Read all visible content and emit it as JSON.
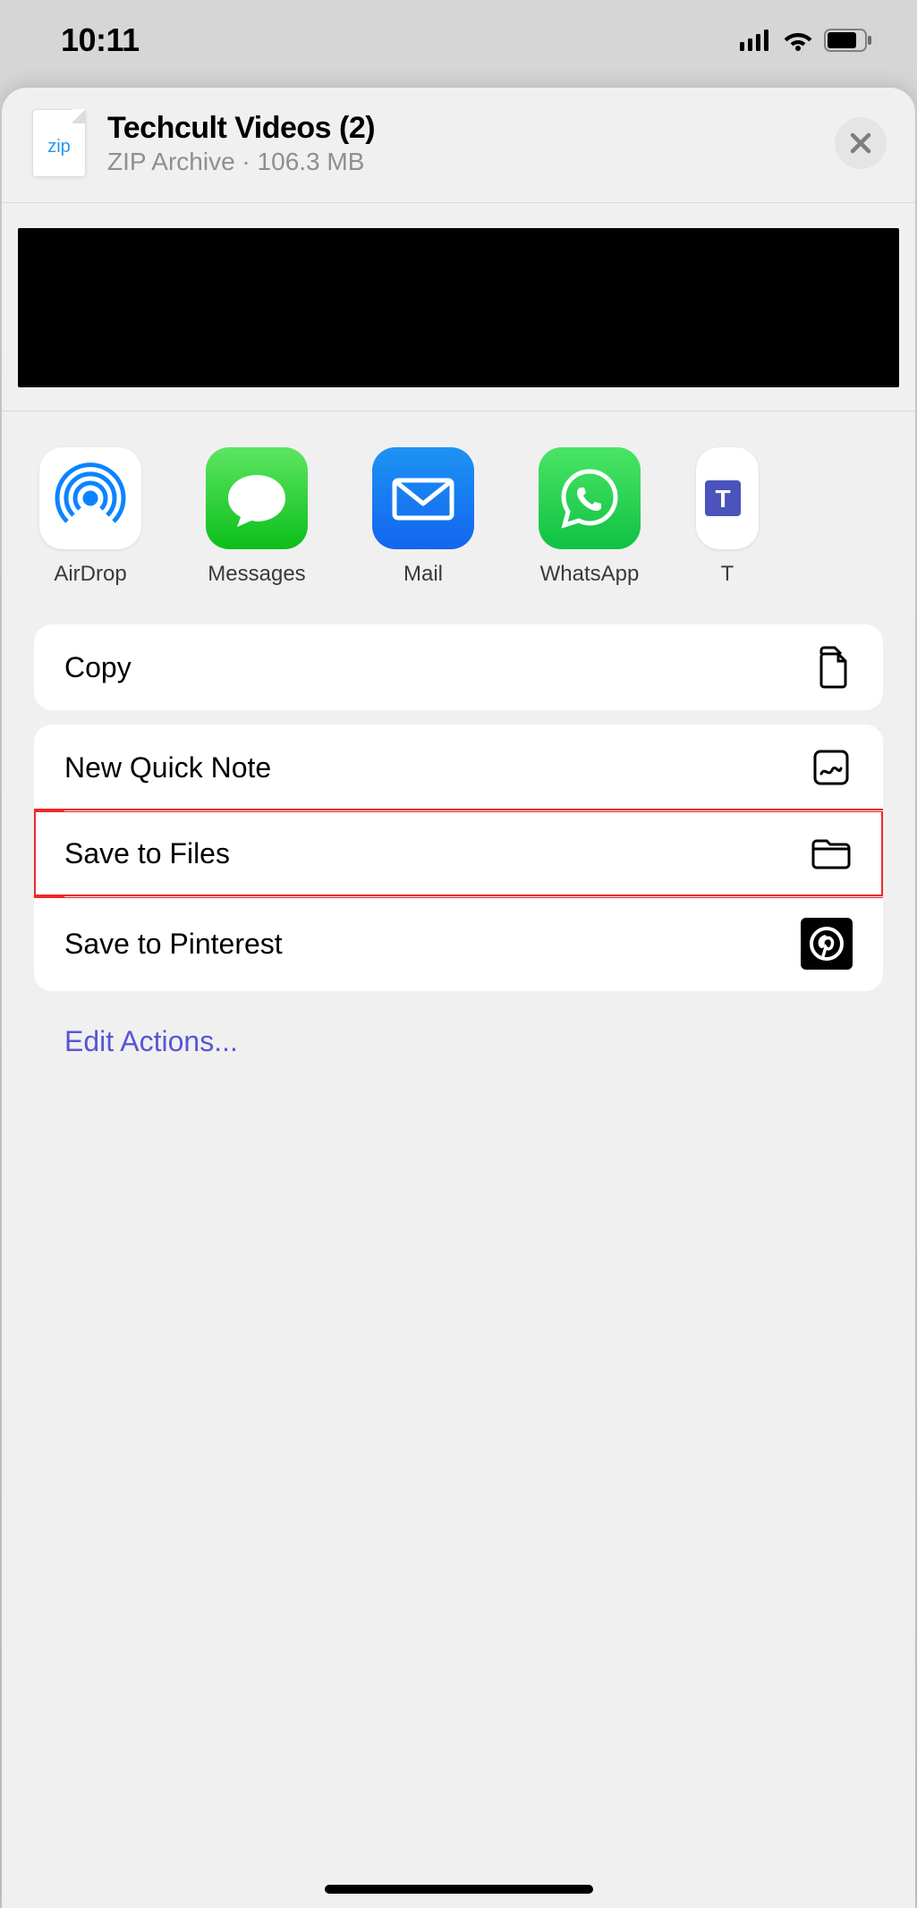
{
  "status_bar": {
    "time": "10:11"
  },
  "file": {
    "name": "Techcult Videos (2)",
    "kind": "ZIP Archive",
    "size": "106.3 MB",
    "thumb_label": "zip"
  },
  "apps": {
    "airdrop": "AirDrop",
    "messages": "Messages",
    "mail": "Mail",
    "whatsapp": "WhatsApp",
    "teams": "T"
  },
  "actions": {
    "copy": "Copy",
    "quick_note": "New Quick Note",
    "save_to_files": "Save to Files",
    "save_to_pinterest": "Save to Pinterest",
    "edit": "Edit Actions..."
  }
}
